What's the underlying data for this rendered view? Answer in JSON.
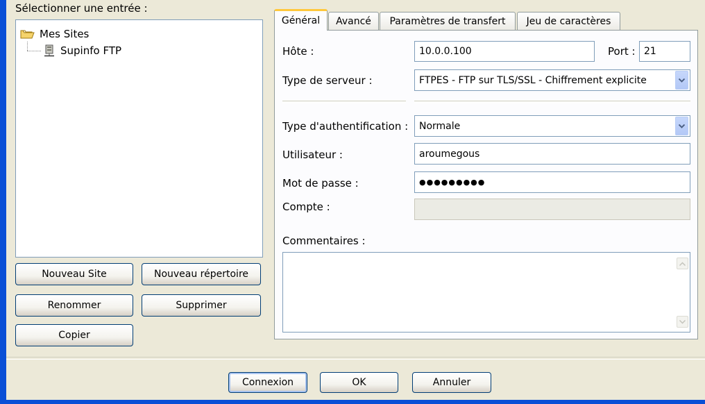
{
  "site_selector": {
    "label": "Sélectionner une entrée :",
    "tree": {
      "root": "Mes Sites",
      "child": "Supinfo FTP"
    }
  },
  "site_buttons": {
    "new_site": "Nouveau Site",
    "new_folder": "Nouveau répertoire",
    "rename": "Renommer",
    "delete": "Supprimer",
    "copy": "Copier"
  },
  "tabs": [
    "Général",
    "Avancé",
    "Paramètres de transfert",
    "Jeu de caractères"
  ],
  "general": {
    "host_label": "Hôte :",
    "host_value": "10.0.0.100",
    "port_label": "Port :",
    "port_value": "21",
    "server_type_label": "Type de serveur :",
    "server_type_value": "FTPES - FTP sur TLS/SSL - Chiffrement explicite",
    "auth_type_label": "Type d'authentification :",
    "auth_type_value": "Normale",
    "user_label": "Utilisateur :",
    "user_value": "aroumegous",
    "password_label": "Mot de passe :",
    "password_value": "●●●●●●●●●",
    "account_label": "Compte :",
    "account_value": "",
    "comments_label": "Commentaires :",
    "comments_value": ""
  },
  "dialog_buttons": {
    "connect": "Connexion",
    "ok": "OK",
    "cancel": "Annuler"
  },
  "icons": {
    "folder": "folder-open-icon",
    "site": "server-icon",
    "combo_arrow": "chevron-down-icon",
    "scroll_up": "scroll-up-icon",
    "scroll_down": "scroll-down-icon"
  },
  "colors": {
    "window_frame": "#0a4fd6",
    "dialog_bg": "#ece9d8",
    "active_tab_accent": "#ffc83c"
  }
}
